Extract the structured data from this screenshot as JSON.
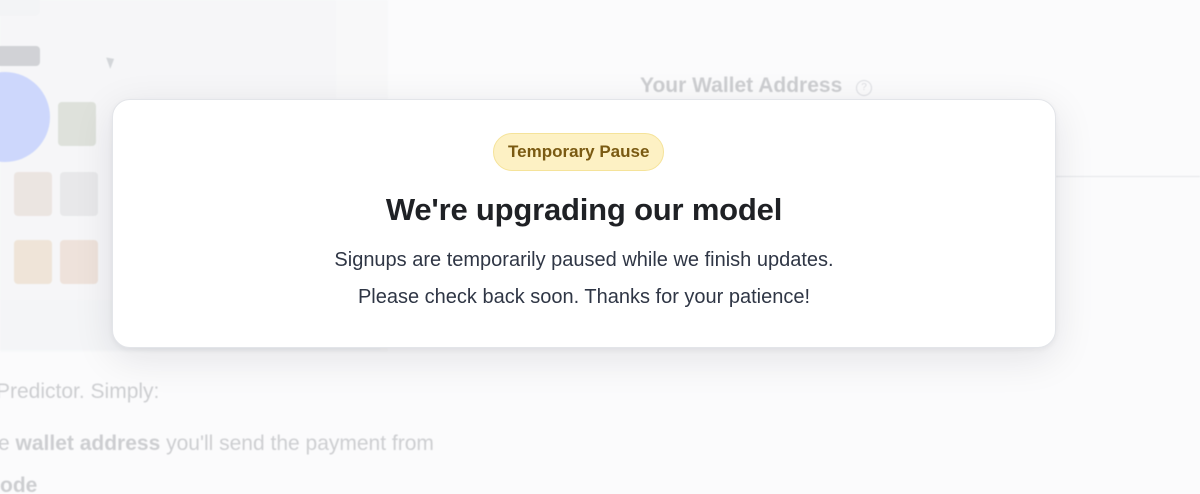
{
  "background": {
    "wallet_section_title": "Your Wallet Address",
    "help_icon": "question-circle-icon",
    "help_glyph": "?",
    "intro_text": "Predictor. Simply:",
    "step_1": {
      "prefix": "e ",
      "bold": "wallet address",
      "suffix": " you'll send the payment from"
    },
    "step_2_bold": "ode"
  },
  "modal": {
    "badge_label": "Temporary Pause",
    "title": "We're upgrading our model",
    "message_line_1": "Signups are temporarily paused while we finish updates.",
    "message_line_2": "Please check back soon. Thanks for your patience!"
  },
  "colors": {
    "badge_background": "#fdf1c4",
    "badge_text": "#7a5a12",
    "title_text": "#1f2125",
    "body_text": "#2f3645",
    "accent_blue": "#2f5cff"
  }
}
